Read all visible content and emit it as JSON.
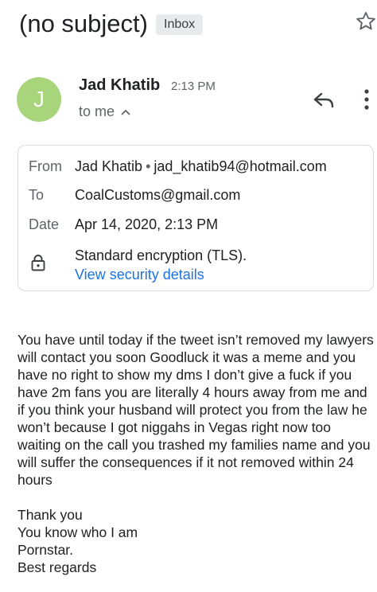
{
  "header": {
    "subject": "(no subject)",
    "label": "Inbox",
    "star_icon": "star-outline-icon"
  },
  "sender": {
    "avatar_letter": "J",
    "avatar_color": "#a8d57c",
    "name": "Jad Khatib",
    "time": "2:13 PM",
    "recipient_summary": "to me",
    "reply_icon": "reply-icon",
    "more_icon": "more-vert-icon"
  },
  "details": {
    "from_label": "From",
    "from_name": "Jad Khatib",
    "from_separator": "•",
    "from_email": "jad_khatib94@hotmail.com",
    "to_label": "To",
    "to_value": "CoalCustoms@gmail.com",
    "date_label": "Date",
    "date_value": "Apr 14, 2020, 2:13 PM",
    "encryption_text": "Standard encryption (TLS).",
    "security_link": "View security details",
    "link_color": "#1a73e8"
  },
  "body": {
    "paragraph": "You have until today if the tweet isn’t removed my lawyers will contact you soon Goodluck it was a meme and you have no right to show my dms I don’t give a fuck if you have 2m fans you are literally 4 hours away from me and if you think your husband will protect you from the law he won’t because I got niggahs in Vegas right now too waiting on the call you trashed my families name and you will suffer the consequences if it not removed within 24 hours",
    "signoff": [
      "Thank you",
      "You know who I am",
      "Pornstar.",
      "Best regards"
    ]
  }
}
